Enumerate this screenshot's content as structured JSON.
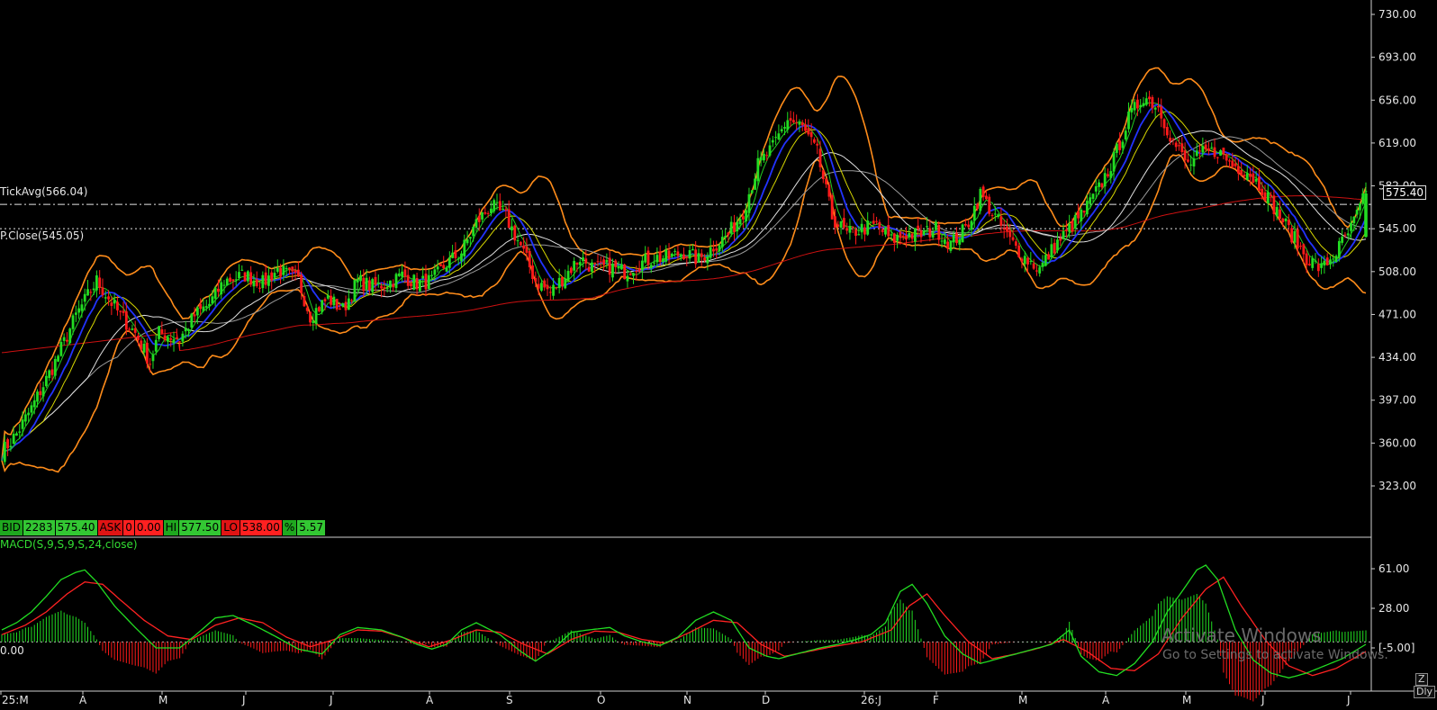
{
  "overlays": {
    "tick_avg": "TickAvg(566.04)",
    "prev_close": "P.Close(545.05)",
    "price_tag": "575.40",
    "zero_label": "0.00"
  },
  "quote": {
    "bid_label": "BID",
    "bid_qty": "2283",
    "bid_price": "575.40",
    "ask_label": "ASK",
    "ask_qty": "0",
    "ask_price": "0.00",
    "hi_label": "HI",
    "hi_value": "577.50",
    "lo_label": "LO",
    "lo_value": "538.00",
    "pct_label": "%",
    "pct_value": "5.57"
  },
  "macd_label": "MACD(S,9,S,9,S,24,close)",
  "corner": {
    "z_button": "Z",
    "period_button": "Dly"
  },
  "watermark": {
    "line1": "Activate Windows",
    "line2": "Go to Settings to activate Windows."
  },
  "colors": {
    "up": "#22dd22",
    "down": "#ff1a1a",
    "bollinger": "#ff8c1a",
    "ma_blue": "#2233ff",
    "ma_white": "#e0e0e0",
    "ma_gray": "#9a9a9a",
    "ma_yellow": "#d6d600",
    "ma_green": "#22cc22",
    "ma_red": "#cc1111",
    "macd": "#22dd22",
    "signal": "#ff2222"
  },
  "chart_data": [
    {
      "type": "candlestick",
      "ylim": [
        290,
        735
      ],
      "y_ticks": [
        "730.00",
        "693.00",
        "656.00",
        "619.00",
        "582.00",
        "545.00",
        "508.00",
        "471.00",
        "434.00",
        "397.00",
        "360.00",
        "323.00"
      ],
      "x_ticks": [
        "25:M",
        "A",
        "M",
        "J",
        "J",
        "A",
        "S",
        "O",
        "N",
        "D",
        "26:J",
        "F",
        "M",
        "A",
        "M",
        "J",
        "J"
      ],
      "reference_lines": {
        "tick_avg": 566.04,
        "prev_close": 545.05
      },
      "last_price": 575.4,
      "close_path": [
        [
          0,
          352
        ],
        [
          5,
          368
        ],
        [
          10,
          390
        ],
        [
          18,
          430
        ],
        [
          25,
          470
        ],
        [
          32,
          500
        ],
        [
          40,
          470
        ],
        [
          45,
          455
        ],
        [
          50,
          430
        ],
        [
          53,
          455
        ],
        [
          60,
          450
        ],
        [
          65,
          470
        ],
        [
          70,
          480
        ],
        [
          75,
          500
        ],
        [
          82,
          505
        ],
        [
          88,
          498
        ],
        [
          93,
          510
        ],
        [
          100,
          500
        ],
        [
          104,
          470
        ],
        [
          110,
          485
        ],
        [
          115,
          475
        ],
        [
          120,
          500
        ],
        [
          125,
          495
        ],
        [
          130,
          498
        ],
        [
          135,
          505
        ],
        [
          140,
          498
        ],
        [
          145,
          500
        ],
        [
          150,
          515
        ],
        [
          155,
          525
        ],
        [
          160,
          550
        ],
        [
          165,
          565
        ],
        [
          170,
          555
        ],
        [
          175,
          530
        ],
        [
          180,
          500
        ],
        [
          185,
          490
        ],
        [
          190,
          505
        ],
        [
          195,
          520
        ],
        [
          200,
          510
        ],
        [
          205,
          512
        ],
        [
          210,
          508
        ],
        [
          215,
          515
        ],
        [
          220,
          520
        ],
        [
          225,
          520
        ],
        [
          230,
          525
        ],
        [
          235,
          518
        ],
        [
          240,
          530
        ],
        [
          245,
          540
        ],
        [
          250,
          560
        ],
        [
          255,
          600
        ],
        [
          260,
          615
        ],
        [
          265,
          640
        ],
        [
          270,
          632
        ],
        [
          275,
          610
        ],
        [
          280,
          555
        ],
        [
          285,
          540
        ],
        [
          290,
          545
        ],
        [
          295,
          548
        ],
        [
          300,
          535
        ],
        [
          305,
          540
        ],
        [
          310,
          540
        ],
        [
          315,
          545
        ],
        [
          320,
          532
        ],
        [
          325,
          545
        ],
        [
          330,
          575
        ],
        [
          335,
          555
        ],
        [
          340,
          535
        ],
        [
          345,
          520
        ],
        [
          350,
          510
        ],
        [
          355,
          530
        ],
        [
          360,
          545
        ],
        [
          365,
          560
        ],
        [
          370,
          580
        ],
        [
          375,
          605
        ],
        [
          380,
          640
        ],
        [
          385,
          660
        ],
        [
          390,
          650
        ],
        [
          395,
          620
        ],
        [
          400,
          600
        ],
        [
          405,
          610
        ],
        [
          410,
          612
        ],
        [
          415,
          600
        ],
        [
          420,
          595
        ],
        [
          425,
          580
        ],
        [
          430,
          560
        ],
        [
          435,
          540
        ],
        [
          440,
          520
        ],
        [
          445,
          510
        ],
        [
          450,
          525
        ],
        [
          455,
          545
        ],
        [
          460,
          575
        ]
      ]
    },
    {
      "type": "bar+line",
      "label": "MACD(S,9,S,9,S,24,close)",
      "ylim": [
        -40,
        75
      ],
      "y_ticks": [
        "61.00",
        "28.00",
        "[-5.00]"
      ],
      "zero": 0.0,
      "macd": [
        [
          0,
          10
        ],
        [
          5,
          16
        ],
        [
          10,
          25
        ],
        [
          15,
          38
        ],
        [
          20,
          52
        ],
        [
          25,
          58
        ],
        [
          28,
          60
        ],
        [
          32,
          50
        ],
        [
          38,
          30
        ],
        [
          45,
          12
        ],
        [
          52,
          -5
        ],
        [
          60,
          -5
        ],
        [
          65,
          5
        ],
        [
          72,
          20
        ],
        [
          78,
          22
        ],
        [
          85,
          14
        ],
        [
          92,
          5
        ],
        [
          100,
          -6
        ],
        [
          108,
          -10
        ],
        [
          114,
          6
        ],
        [
          120,
          12
        ],
        [
          128,
          10
        ],
        [
          135,
          4
        ],
        [
          140,
          -2
        ],
        [
          145,
          -6
        ],
        [
          150,
          -2
        ],
        [
          155,
          10
        ],
        [
          160,
          16
        ],
        [
          168,
          6
        ],
        [
          175,
          -8
        ],
        [
          180,
          -16
        ],
        [
          186,
          -6
        ],
        [
          192,
          8
        ],
        [
          198,
          10
        ],
        [
          205,
          12
        ],
        [
          210,
          5
        ],
        [
          216,
          0
        ],
        [
          222,
          -3
        ],
        [
          228,
          4
        ],
        [
          234,
          18
        ],
        [
          240,
          25
        ],
        [
          246,
          18
        ],
        [
          252,
          -5
        ],
        [
          258,
          -12
        ],
        [
          262,
          -14
        ],
        [
          268,
          -10
        ],
        [
          276,
          -5
        ],
        [
          282,
          -2
        ],
        [
          288,
          2
        ],
        [
          293,
          6
        ],
        [
          298,
          16
        ],
        [
          303,
          42
        ],
        [
          307,
          48
        ],
        [
          312,
          32
        ],
        [
          318,
          5
        ],
        [
          324,
          -10
        ],
        [
          330,
          -18
        ],
        [
          336,
          -14
        ],
        [
          342,
          -10
        ],
        [
          348,
          -6
        ],
        [
          354,
          -2
        ],
        [
          360,
          10
        ],
        [
          364,
          -12
        ],
        [
          370,
          -25
        ],
        [
          376,
          -28
        ],
        [
          382,
          -18
        ],
        [
          388,
          0
        ],
        [
          393,
          25
        ],
        [
          398,
          42
        ],
        [
          403,
          60
        ],
        [
          406,
          64
        ],
        [
          410,
          52
        ],
        [
          416,
          10
        ],
        [
          422,
          -15
        ],
        [
          428,
          -26
        ],
        [
          434,
          -30
        ],
        [
          440,
          -26
        ],
        [
          446,
          -20
        ],
        [
          452,
          -14
        ],
        [
          460,
          -2
        ]
      ],
      "signal": [
        [
          0,
          6
        ],
        [
          8,
          14
        ],
        [
          15,
          25
        ],
        [
          22,
          40
        ],
        [
          28,
          50
        ],
        [
          34,
          48
        ],
        [
          40,
          35
        ],
        [
          48,
          18
        ],
        [
          56,
          5
        ],
        [
          64,
          2
        ],
        [
          72,
          14
        ],
        [
          80,
          20
        ],
        [
          88,
          16
        ],
        [
          96,
          4
        ],
        [
          104,
          -4
        ],
        [
          112,
          2
        ],
        [
          120,
          10
        ],
        [
          128,
          9
        ],
        [
          136,
          3
        ],
        [
          144,
          -4
        ],
        [
          152,
          2
        ],
        [
          160,
          10
        ],
        [
          168,
          8
        ],
        [
          176,
          -2
        ],
        [
          184,
          -10
        ],
        [
          192,
          2
        ],
        [
          200,
          9
        ],
        [
          208,
          8
        ],
        [
          216,
          2
        ],
        [
          224,
          -1
        ],
        [
          232,
          8
        ],
        [
          240,
          18
        ],
        [
          248,
          16
        ],
        [
          256,
          -2
        ],
        [
          264,
          -12
        ],
        [
          272,
          -8
        ],
        [
          280,
          -4
        ],
        [
          290,
          0
        ],
        [
          300,
          10
        ],
        [
          306,
          30
        ],
        [
          312,
          40
        ],
        [
          318,
          22
        ],
        [
          326,
          0
        ],
        [
          334,
          -14
        ],
        [
          342,
          -10
        ],
        [
          350,
          -5
        ],
        [
          358,
          2
        ],
        [
          366,
          -8
        ],
        [
          374,
          -22
        ],
        [
          382,
          -24
        ],
        [
          390,
          -10
        ],
        [
          398,
          20
        ],
        [
          406,
          44
        ],
        [
          412,
          54
        ],
        [
          418,
          30
        ],
        [
          426,
          2
        ],
        [
          434,
          -20
        ],
        [
          442,
          -28
        ],
        [
          450,
          -22
        ],
        [
          460,
          -8
        ]
      ]
    }
  ]
}
